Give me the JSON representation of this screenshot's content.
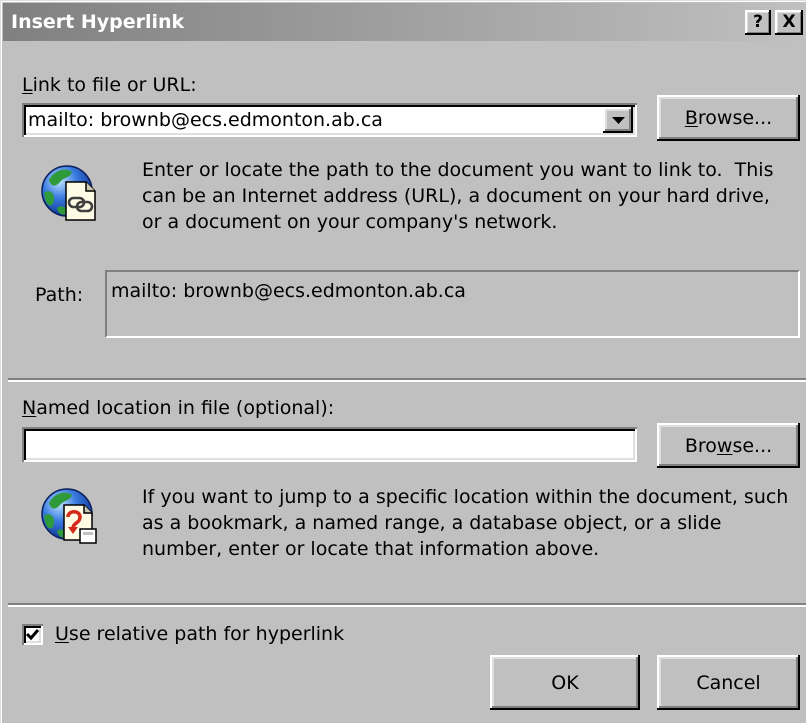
{
  "window": {
    "title": "Insert Hyperlink",
    "help_button": "?",
    "close_button": "X"
  },
  "theme": {
    "dialog_bg": "#c0c0c0",
    "title_bar_start": "#808080",
    "title_bar_end": "#c0c0c0",
    "title_text": "#ffffff",
    "field_bg": "#ffffff"
  },
  "link_section": {
    "label": "Link to file or URL:",
    "label_accel": "L",
    "url_value": "mailto: brownb@ecs.edmonton.ab.ca",
    "dropdown_icon": "chevron-down-icon",
    "browse_label": "Browse...",
    "browse_accel": "B",
    "icon": "globe-document-link-icon",
    "help_lines": [
      "Enter or locate the path to the document you want to link to.  This",
      "can be an Internet address (URL), a document on your hard drive,",
      "or a document on your company's network."
    ],
    "path_label": "Path:",
    "path_value": "mailto: brownb@ecs.edmonton.ab.ca"
  },
  "location_section": {
    "label": "Named location in file (optional):",
    "label_accel": "N",
    "value": "",
    "browse_label": "Browse...",
    "browse_accel": "w",
    "icon": "globe-document-bookmark-icon",
    "help_lines": [
      "If you want to jump to a specific location within the document, such",
      "as a bookmark, a named range, a database object, or a slide",
      "number, enter or locate that information above."
    ]
  },
  "options": {
    "relative_path_label": "Use relative path for hyperlink",
    "relative_path_accel": "U",
    "relative_path_checked": true
  },
  "footer": {
    "ok_label": "OK",
    "cancel_label": "Cancel"
  }
}
